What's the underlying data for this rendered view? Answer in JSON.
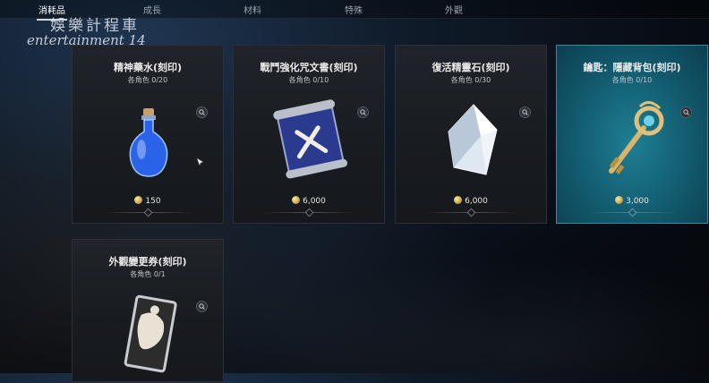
{
  "tabs": [
    {
      "label": "消耗品",
      "active": true
    },
    {
      "label": "成長",
      "active": false
    },
    {
      "label": "材料",
      "active": false
    },
    {
      "label": "特殊",
      "active": false
    },
    {
      "label": "外觀",
      "active": false
    }
  ],
  "watermark": {
    "cn": "娛樂計程車",
    "en": "entertainment 14"
  },
  "items": [
    {
      "title": "精神藥水(刻印)",
      "limit": "各角色  0/20",
      "price": "150",
      "icon": "blue-potion-icon",
      "selected": false
    },
    {
      "title": "戰鬥強化咒文書(刻印)",
      "limit": "各角色  0/10",
      "price": "6,000",
      "icon": "scroll-icon",
      "selected": false
    },
    {
      "title": "復活精靈石(刻印)",
      "limit": "各角色  0/30",
      "price": "6,000",
      "icon": "crystal-icon",
      "selected": false
    },
    {
      "title": "鑰匙：隱藏背包(刻印)",
      "limit": "各角色  0/10",
      "price": "3,000",
      "icon": "key-icon",
      "selected": true
    },
    {
      "title": "外觀變更券(刻印)",
      "limit": "各角色  0/1",
      "price": "",
      "icon": "ticket-icon",
      "selected": false
    }
  ],
  "colors": {
    "selected_card": "#125a6e",
    "coin": "#c59a3a"
  }
}
